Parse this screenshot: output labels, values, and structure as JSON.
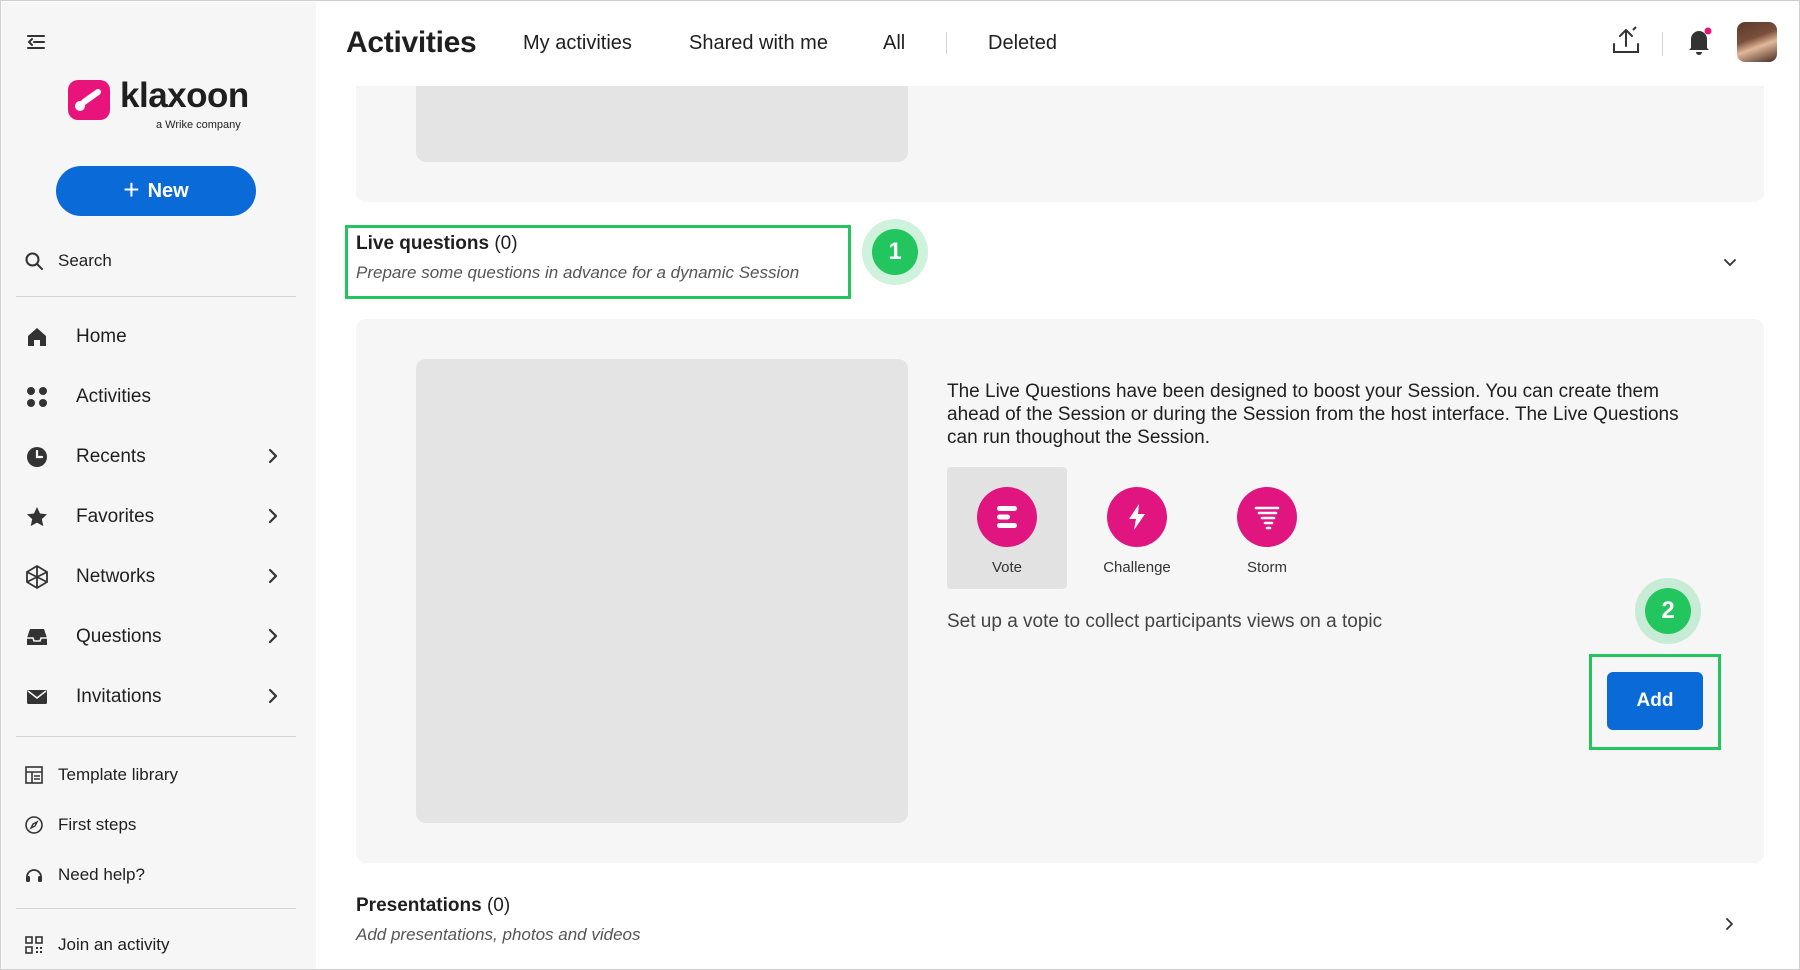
{
  "sidebar": {
    "logo_text": "klaxoon",
    "logo_sub": "a Wrike company",
    "new_label": "New",
    "search_label": "Search",
    "nav": [
      {
        "label": "Home",
        "icon": "home-icon"
      },
      {
        "label": "Activities",
        "icon": "activities-icon"
      },
      {
        "label": "Recents",
        "icon": "clock-icon"
      },
      {
        "label": "Favorites",
        "icon": "star-icon"
      },
      {
        "label": "Networks",
        "icon": "network-icon"
      },
      {
        "label": "Questions",
        "icon": "inbox-icon"
      },
      {
        "label": "Invitations",
        "icon": "envelope-icon"
      }
    ],
    "tools": [
      {
        "label": "Template library",
        "icon": "template-icon"
      },
      {
        "label": "First steps",
        "icon": "compass-icon"
      },
      {
        "label": "Need help?",
        "icon": "help-icon"
      }
    ],
    "join_label": "Join an activity"
  },
  "topbar": {
    "title": "Activities",
    "tabs": [
      "My activities",
      "Shared with me",
      "All",
      "Deleted"
    ],
    "notification_dot_color": "#e8137b"
  },
  "sections": {
    "live_questions": {
      "title": "Live questions",
      "count": "(0)",
      "subtitle": "Prepare some questions in advance for a dynamic Session",
      "description": "The Live Questions have been designed to boost your Session. You can create them ahead of the Session or during the Session from the host interface. The Live Questions can run thoughout the Session.",
      "types": [
        {
          "label": "Vote",
          "icon": "vote-icon",
          "selected": true
        },
        {
          "label": "Challenge",
          "icon": "lightning-icon",
          "selected": false
        },
        {
          "label": "Storm",
          "icon": "tornado-icon",
          "selected": false
        }
      ],
      "helper": "Set up a vote to collect participants views on a topic",
      "add_label": "Add"
    },
    "presentations": {
      "title": "Presentations",
      "count": "(0)",
      "subtitle": "Add presentations, photos and videos"
    }
  },
  "steps": [
    "1",
    "2"
  ],
  "colors": {
    "primary": "#0a6ad7",
    "brand_pink": "#e8137b",
    "highlight_green": "#22c55e"
  }
}
